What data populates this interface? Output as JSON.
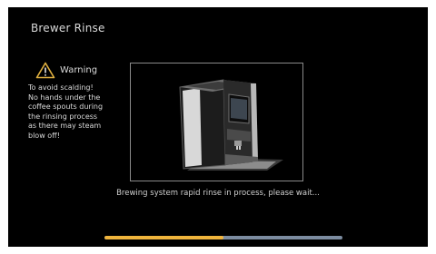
{
  "title": "Brewer Rinse",
  "warning": {
    "icon": "warning-triangle-icon",
    "label": "Warning",
    "message": "To avoid scalding!\nNo hands under the\ncoffee spouts during\nthe rinsing process\nas there may steam\nblow off!"
  },
  "illustration": {
    "icon": "coffee-machine-icon"
  },
  "status_text": "Brewing system rapid rinse in process, please wait...",
  "progress": {
    "fraction": 0.5,
    "fill_color": "#f0b43c",
    "track_color": "#7c8ca0"
  },
  "colors": {
    "background": "#000000",
    "text": "#d9d9d9",
    "accent": "#f0b43c"
  }
}
